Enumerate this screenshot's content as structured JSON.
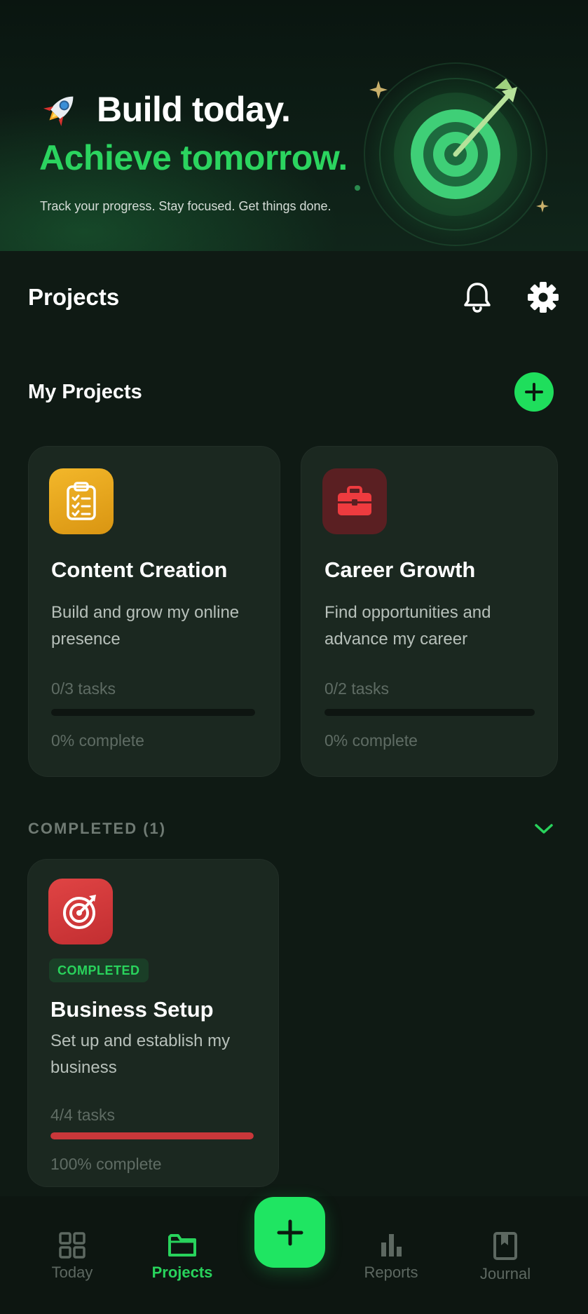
{
  "hero": {
    "title_line1": "Build today.",
    "title_line2": "Achieve tomorrow.",
    "subtitle": "Track your progress. Stay focused. Get things done."
  },
  "header": {
    "title": "Projects",
    "notification_icon": "bell-icon",
    "settings_icon": "gear-icon"
  },
  "my_projects": {
    "title": "My Projects",
    "add_icon": "plus-icon",
    "cards": [
      {
        "title": "Content Creation",
        "description": "Build and grow my online presence",
        "tasks": "0/3 tasks",
        "progress": 0,
        "complete_label": "0% complete",
        "icon": "clipboard-checklist-icon",
        "icon_color": "#e6a81b"
      },
      {
        "title": "Career Growth",
        "description": "Find opportunities and advance my career",
        "tasks": "0/2 tasks",
        "progress": 0,
        "complete_label": "0% complete",
        "icon": "briefcase-icon",
        "icon_color": "#5a1f22"
      }
    ]
  },
  "completed": {
    "label": "COMPLETED (1)",
    "toggle_icon": "chevron-down-icon",
    "cards": [
      {
        "badge": "COMPLETED",
        "title": "Business Setup",
        "description": "Set up and establish my business",
        "tasks": "4/4 tasks",
        "progress": 1.0,
        "complete_label": "100% complete",
        "icon": "target-arrow-icon",
        "icon_color": "#d23a3a",
        "bar_color": "#c9373a"
      }
    ]
  },
  "nav": {
    "items": [
      {
        "label": "Today",
        "icon": "grid-icon",
        "active": false
      },
      {
        "label": "Projects",
        "icon": "folder-icon",
        "active": true
      },
      {
        "label": "Reports",
        "icon": "bar-chart-icon",
        "active": false
      },
      {
        "label": "Journal",
        "icon": "journal-icon",
        "active": false
      }
    ],
    "fab_icon": "plus-icon"
  },
  "colors": {
    "accent": "#1fde5c",
    "background": "#0f1a14",
    "card": "#1b2820"
  }
}
